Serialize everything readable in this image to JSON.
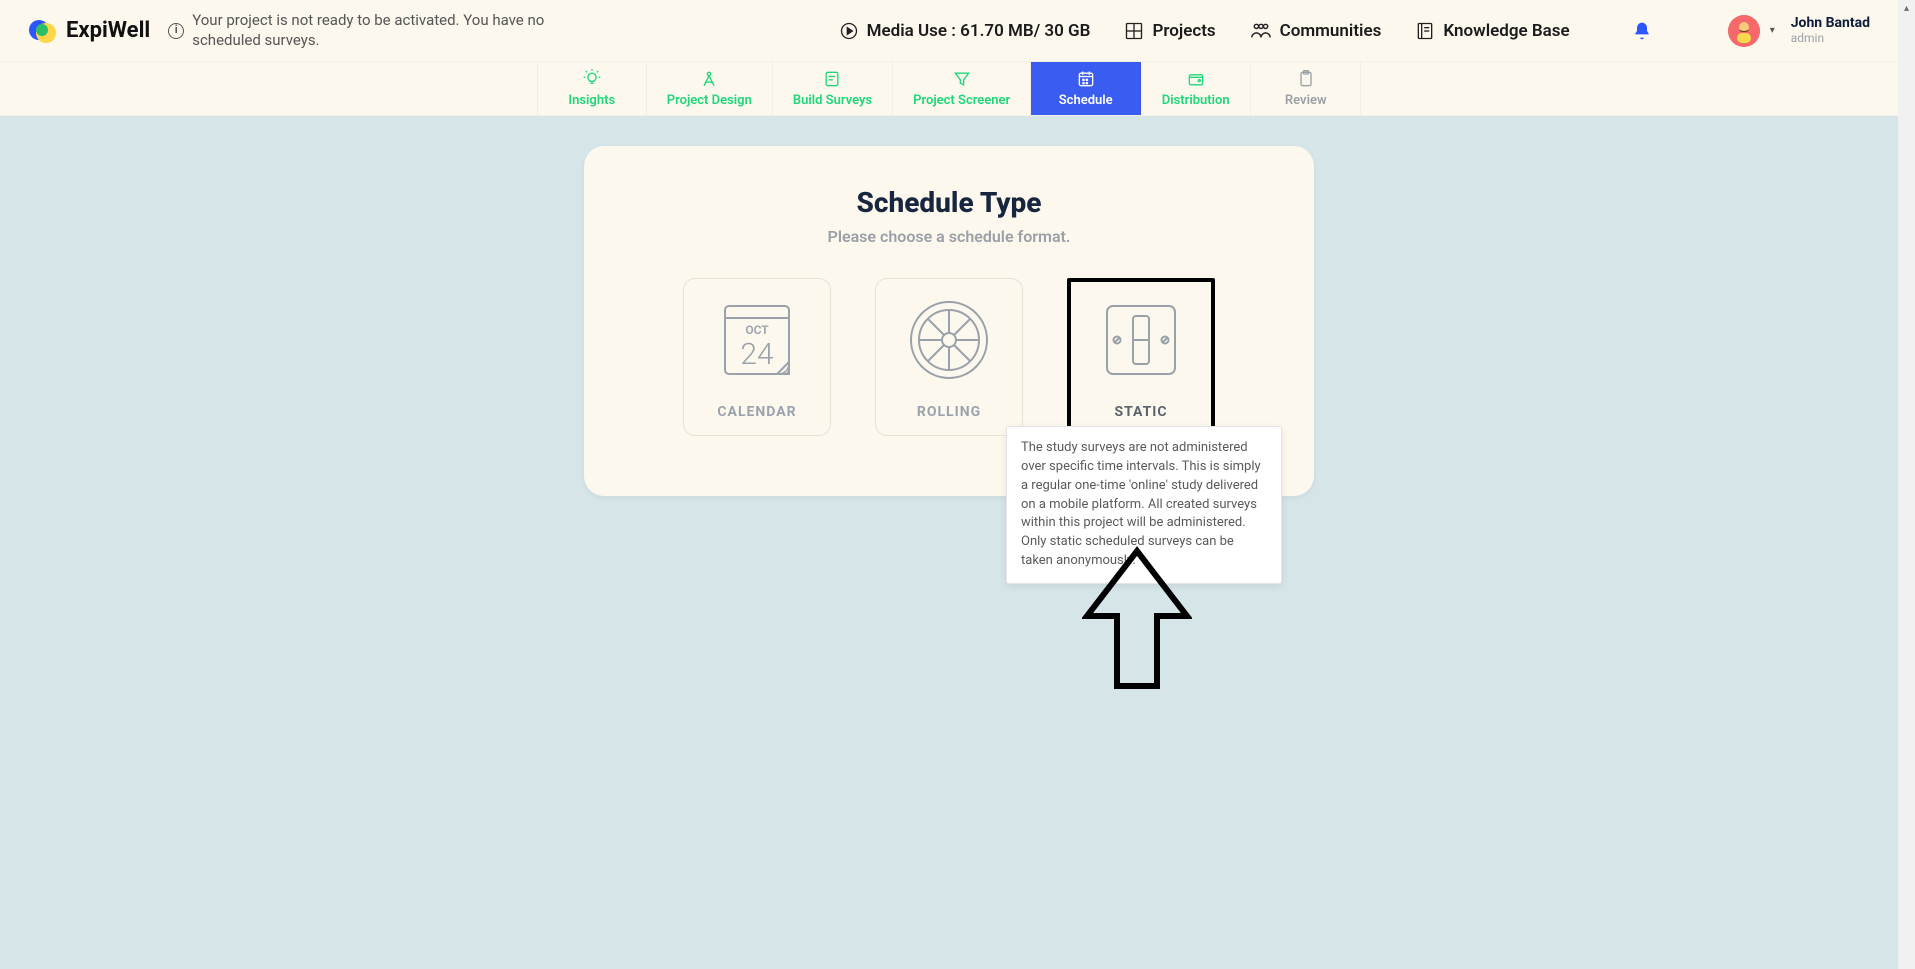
{
  "brand": {
    "name": "ExpiWell"
  },
  "header": {
    "status": "Your project is not ready to be activated. You have no scheduled surveys.",
    "media_use_label": "Media Use : 61.70 MB/ 30 GB",
    "projects": "Projects",
    "communities": "Communities",
    "knowledge_base": "Knowledge Base"
  },
  "user": {
    "name": "John Bantad",
    "role": "admin"
  },
  "tabs": {
    "insights": "Insights",
    "project_design": "Project Design",
    "build_surveys": "Build Surveys",
    "project_screener": "Project Screener",
    "schedule": "Schedule",
    "distribution": "Distribution",
    "review": "Review"
  },
  "schedule_panel": {
    "title": "Schedule Type",
    "subtitle": "Please choose a schedule format.",
    "calendar_month": "OCT",
    "calendar_day": "24",
    "types": {
      "calendar": "CALENDAR",
      "rolling": "ROLLING",
      "static": "STATIC"
    },
    "static_tooltip": "The study surveys are not administered over specific time intervals. This is simply a regular one-time 'online' study delivered on a mobile platform. All created surveys within this project will be administered. Only static scheduled surveys can be taken anonymously."
  }
}
